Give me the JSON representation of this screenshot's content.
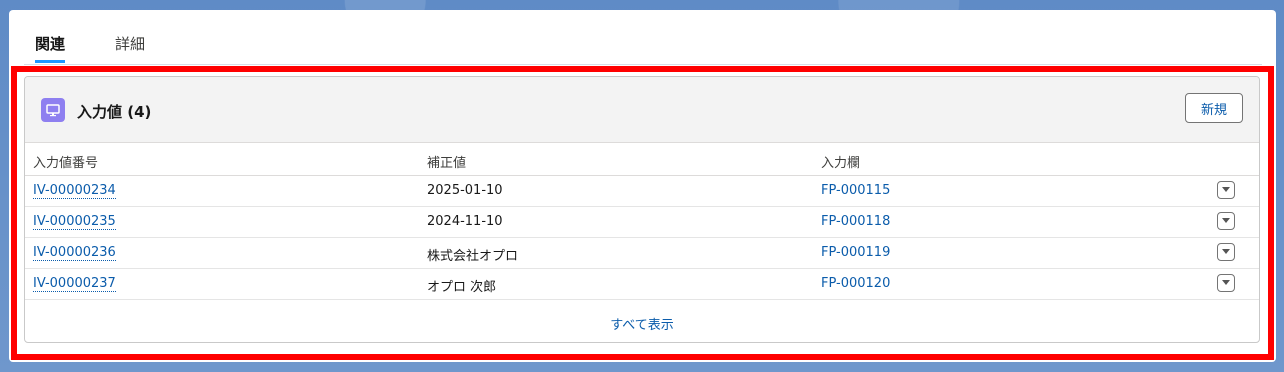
{
  "tabs": [
    {
      "label": "関連",
      "active": true
    },
    {
      "label": "詳細",
      "active": false
    }
  ],
  "panel": {
    "icon": "monitor-icon",
    "title": "入力値 (4)",
    "new_button": "新規",
    "columns": [
      "入力値番号",
      "補正値",
      "入力欄"
    ],
    "rows": [
      {
        "id": "IV-00000234",
        "value": "2025-01-10",
        "field": "FP-000115"
      },
      {
        "id": "IV-00000235",
        "value": "2024-11-10",
        "field": "FP-000118"
      },
      {
        "id": "IV-00000236",
        "value": "株式会社オプロ",
        "field": "FP-000119"
      },
      {
        "id": "IV-00000237",
        "value": "オプロ 次郎",
        "field": "FP-000120"
      }
    ],
    "view_all": "すべて表示"
  },
  "colors": {
    "accent": "#0b5cab",
    "highlight": "#ff0000",
    "icon_bg": "#8e7ff0"
  }
}
